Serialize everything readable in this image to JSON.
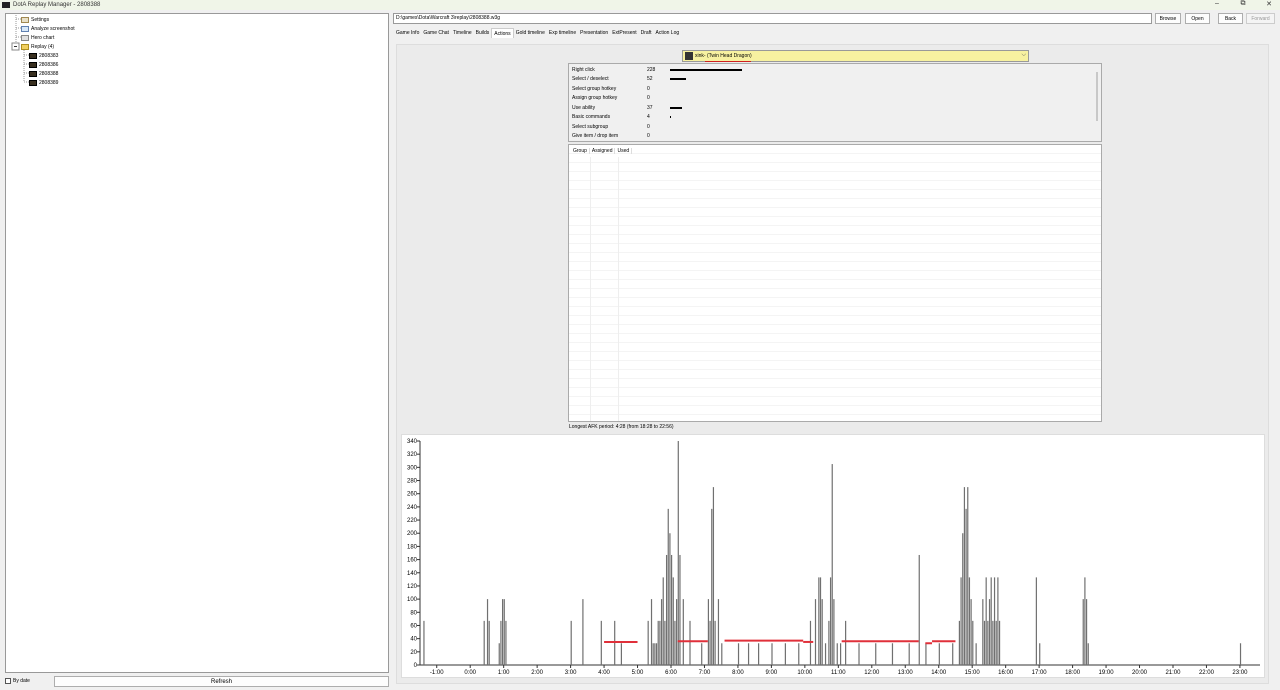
{
  "window": {
    "title": "DotA Replay Manager - 2808388",
    "controls": [
      "–",
      "⧉",
      "✕"
    ]
  },
  "tree": {
    "items": [
      {
        "label": "Settings",
        "icon": "settings-icon"
      },
      {
        "label": "Analyze screenshot",
        "icon": "screenshot-icon"
      },
      {
        "label": "Hero chart",
        "icon": "chart-icon"
      },
      {
        "label": "Replay (4)",
        "icon": "folder-icon"
      },
      {
        "label": "2808383",
        "icon": "replay-icon"
      },
      {
        "label": "2808386",
        "icon": "replay-icon"
      },
      {
        "label": "2808388",
        "icon": "replay-icon"
      },
      {
        "label": "2808389",
        "icon": "replay-icon"
      }
    ],
    "expander": "⊟"
  },
  "bottom": {
    "by_date": "By date",
    "refresh": "Refresh"
  },
  "toolbar": {
    "path": "D:\\games\\Dota\\Warcraft 3\\replay\\2808388.w3g",
    "browse": "Browse",
    "open": "Open",
    "back": "Back",
    "forward": "Forward"
  },
  "tabs": [
    "Game Info",
    "Game Chat",
    "Timeline",
    "Builds",
    "Actions",
    "Gold timeline",
    "Exp timeline",
    "Presentation",
    "ExtPresent",
    "Draft",
    "Action Log"
  ],
  "active_tab": "Actions",
  "player_select": {
    "value": "xink- (Twin Head Dragon)"
  },
  "stats": [
    {
      "label": "Right click",
      "value": "228",
      "ratio": 1.0
    },
    {
      "label": "Select / deselect",
      "value": "52",
      "ratio": 0.228
    },
    {
      "label": "Select group hotkey",
      "value": "0",
      "ratio": 0
    },
    {
      "label": "Assign group hotkey",
      "value": "0",
      "ratio": 0
    },
    {
      "label": "Use ability",
      "value": "37",
      "ratio": 0.162
    },
    {
      "label": "Basic commands",
      "value": "4",
      "ratio": 0.018
    },
    {
      "label": "Select subgroup",
      "value": "0",
      "ratio": 0
    },
    {
      "label": "Give item / drop item",
      "value": "0",
      "ratio": 0
    }
  ],
  "group_table": {
    "columns": [
      "Group",
      "Assigned",
      "Used"
    ]
  },
  "afk": "Longest AFK period: 4:28 (from 18:28 to 22:56)",
  "colors": {
    "bar": "#707070",
    "apm_line": "#e0303a",
    "selected_player_bg": "#f7f1a0"
  },
  "chart_data": {
    "type": "bar",
    "title": "",
    "xlabel": "",
    "ylabel": "",
    "ylim": [
      0,
      340
    ],
    "xlim": [
      -1.5,
      23.6
    ],
    "yticks": [
      0,
      20,
      40,
      60,
      80,
      100,
      120,
      140,
      160,
      180,
      200,
      220,
      240,
      260,
      280,
      300,
      320,
      340
    ],
    "xtick_labels": [
      "-1:00",
      "0:00",
      "1:00",
      "2:00",
      "3:00",
      "4:00",
      "5:00",
      "6:00",
      "7:00",
      "8:00",
      "9:00",
      "10:00",
      "11:00",
      "12:00",
      "13:00",
      "14:00",
      "15:00",
      "16:00",
      "17:00",
      "18:00",
      "19:00",
      "20:00",
      "21:00",
      "22:00",
      "23:00"
    ],
    "xtick_values": [
      -1,
      0,
      1,
      2,
      3,
      4,
      5,
      6,
      7,
      8,
      9,
      10,
      11,
      12,
      13,
      14,
      15,
      16,
      17,
      18,
      19,
      20,
      21,
      22,
      23
    ],
    "bars": [
      [
        -1.4,
        67
      ],
      [
        0.4,
        67
      ],
      [
        0.5,
        100
      ],
      [
        0.55,
        67
      ],
      [
        0.85,
        33
      ],
      [
        0.9,
        67
      ],
      [
        0.95,
        100
      ],
      [
        1.0,
        100
      ],
      [
        1.05,
        67
      ],
      [
        3.0,
        67
      ],
      [
        3.35,
        100
      ],
      [
        3.9,
        67
      ],
      [
        4.3,
        67
      ],
      [
        4.5,
        33
      ],
      [
        5.3,
        67
      ],
      [
        5.4,
        100
      ],
      [
        5.45,
        33
      ],
      [
        5.5,
        33
      ],
      [
        5.55,
        33
      ],
      [
        5.6,
        67
      ],
      [
        5.65,
        67
      ],
      [
        5.7,
        100
      ],
      [
        5.75,
        133
      ],
      [
        5.8,
        67
      ],
      [
        5.85,
        167
      ],
      [
        5.9,
        237
      ],
      [
        5.95,
        200
      ],
      [
        6.0,
        167
      ],
      [
        6.05,
        133
      ],
      [
        6.1,
        67
      ],
      [
        6.15,
        100
      ],
      [
        6.2,
        340
      ],
      [
        6.25,
        167
      ],
      [
        6.35,
        100
      ],
      [
        6.55,
        67
      ],
      [
        6.9,
        33
      ],
      [
        7.1,
        100
      ],
      [
        7.15,
        67
      ],
      [
        7.2,
        237
      ],
      [
        7.25,
        270
      ],
      [
        7.3,
        67
      ],
      [
        7.4,
        100
      ],
      [
        7.5,
        33
      ],
      [
        8.0,
        33
      ],
      [
        8.3,
        33
      ],
      [
        8.6,
        33
      ],
      [
        9.0,
        33
      ],
      [
        9.4,
        33
      ],
      [
        9.8,
        33
      ],
      [
        10.15,
        67
      ],
      [
        10.3,
        100
      ],
      [
        10.4,
        133
      ],
      [
        10.45,
        133
      ],
      [
        10.5,
        100
      ],
      [
        10.6,
        33
      ],
      [
        10.7,
        67
      ],
      [
        10.75,
        133
      ],
      [
        10.8,
        305
      ],
      [
        10.85,
        100
      ],
      [
        10.95,
        33
      ],
      [
        11.05,
        33
      ],
      [
        11.2,
        67
      ],
      [
        11.6,
        33
      ],
      [
        12.1,
        33
      ],
      [
        12.6,
        33
      ],
      [
        13.1,
        33
      ],
      [
        13.4,
        167
      ],
      [
        13.6,
        33
      ],
      [
        14.0,
        33
      ],
      [
        14.4,
        33
      ],
      [
        14.6,
        67
      ],
      [
        14.65,
        133
      ],
      [
        14.7,
        200
      ],
      [
        14.75,
        270
      ],
      [
        14.8,
        237
      ],
      [
        14.85,
        270
      ],
      [
        14.9,
        133
      ],
      [
        14.95,
        100
      ],
      [
        15.0,
        67
      ],
      [
        15.1,
        33
      ],
      [
        15.3,
        100
      ],
      [
        15.35,
        67
      ],
      [
        15.4,
        133
      ],
      [
        15.45,
        67
      ],
      [
        15.5,
        100
      ],
      [
        15.55,
        133
      ],
      [
        15.6,
        67
      ],
      [
        15.65,
        133
      ],
      [
        15.7,
        67
      ],
      [
        15.75,
        133
      ],
      [
        15.8,
        67
      ],
      [
        16.9,
        133
      ],
      [
        17.0,
        33
      ],
      [
        18.3,
        100
      ],
      [
        18.35,
        133
      ],
      [
        18.4,
        100
      ],
      [
        18.45,
        33
      ],
      [
        23.0,
        33
      ]
    ],
    "series": [
      {
        "type": "apm_segments",
        "values": [
          [
            4.0,
            5.0,
            35
          ],
          [
            6.2,
            7.1,
            36
          ],
          [
            7.6,
            9.95,
            37
          ],
          [
            9.95,
            10.25,
            35
          ],
          [
            11.1,
            13.4,
            36
          ],
          [
            13.6,
            13.8,
            33
          ],
          [
            13.8,
            14.5,
            36
          ]
        ]
      }
    ]
  }
}
